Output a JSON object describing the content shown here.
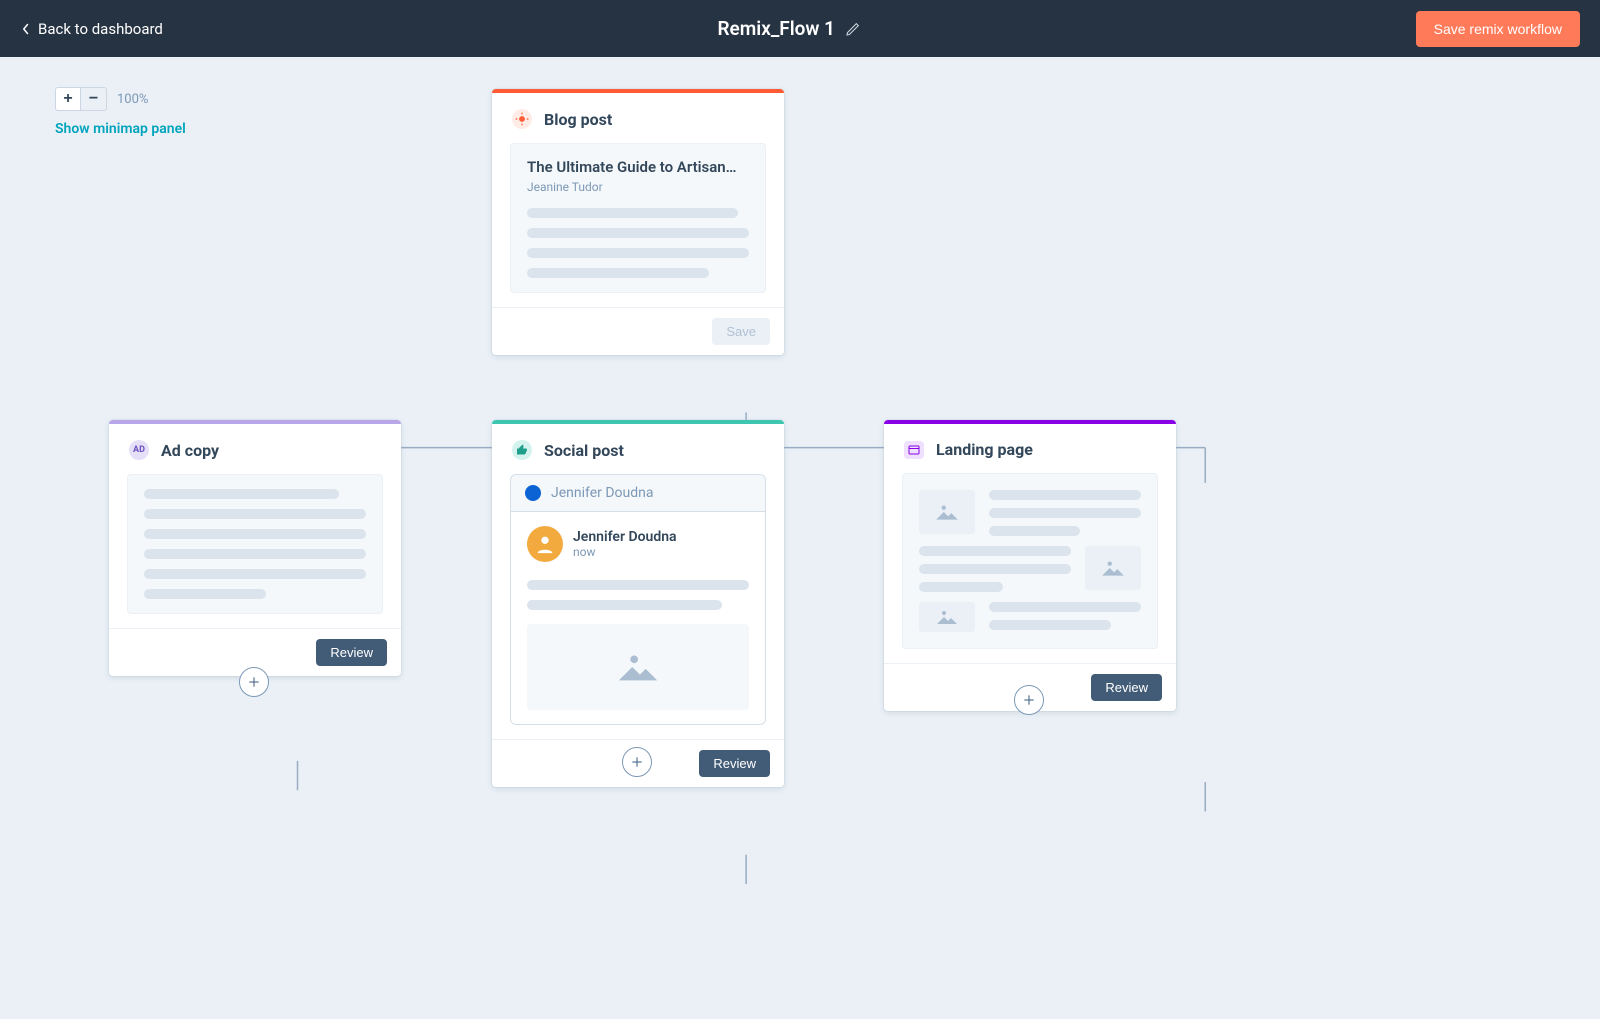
{
  "header": {
    "back_label": "Back to dashboard",
    "title": "Remix_Flow 1",
    "save_label": "Save remix workflow"
  },
  "controls": {
    "zoom_level": "100%",
    "minimap_label": "Show minimap panel"
  },
  "nodes": {
    "blog": {
      "type_label": "Blog post",
      "accent_color": "#ff5c35",
      "icon_bg": "#ffece6",
      "preview_title": "The Ultimate Guide to Artisan…",
      "preview_author": "Jeanine Tudor",
      "footer_button": "Save"
    },
    "ad": {
      "type_label": "Ad copy",
      "accent_color": "#b9a6e8",
      "icon_bg": "#e5dff7",
      "icon_text": "AD",
      "footer_button": "Review"
    },
    "social": {
      "type_label": "Social post",
      "accent_color": "#3ec6b0",
      "icon_bg": "#d5f3ee",
      "compose_name": "Jennifer Doudna",
      "user_name": "Jennifer Doudna",
      "time_label": "now",
      "footer_button": "Review"
    },
    "landing": {
      "type_label": "Landing page",
      "accent_color": "#8a00e6",
      "icon_bg": "#efe0ff",
      "footer_button": "Review"
    }
  }
}
